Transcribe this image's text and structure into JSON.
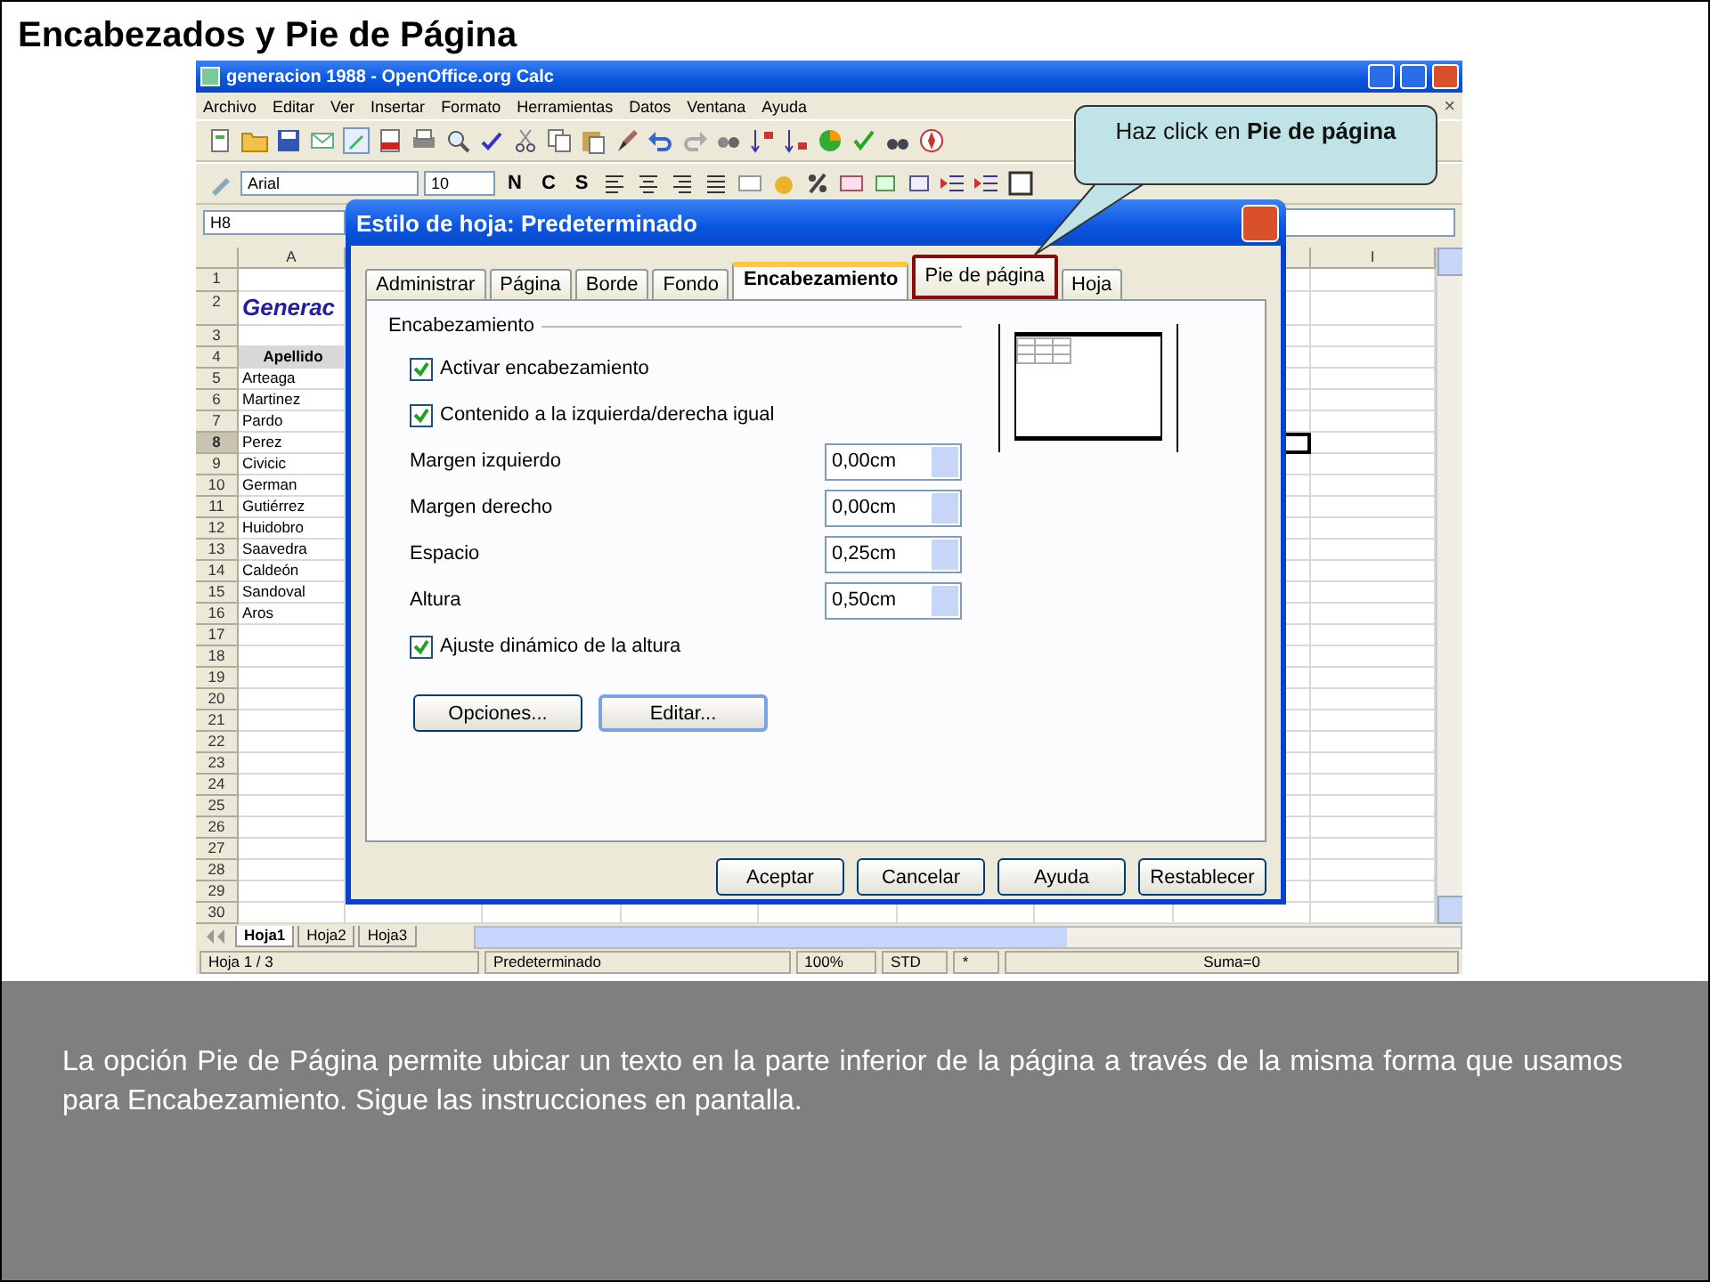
{
  "slide_title": "Encabezados y Pie de Página",
  "window": {
    "title": "generacion 1988 - OpenOffice.org Calc"
  },
  "menu": [
    "Archivo",
    "Editar",
    "Ver",
    "Insertar",
    "Formato",
    "Herramientas",
    "Datos",
    "Ventana",
    "Ayuda"
  ],
  "menu_close": "×",
  "format_toolbar": {
    "font": "Arial",
    "size": "10",
    "style_buttons": [
      "N",
      "C",
      "S"
    ]
  },
  "name_box": "H8",
  "columns": [
    "A",
    "I"
  ],
  "rows": [
    {
      "number": "1",
      "kind": "empty",
      "selected": false
    },
    {
      "number": "2",
      "kind": "title",
      "cell_a": "Generac",
      "selected": false
    },
    {
      "number": "3",
      "kind": "empty",
      "selected": false
    },
    {
      "number": "4",
      "kind": "header",
      "cell_a": "Apellido",
      "selected": false
    },
    {
      "number": "5",
      "kind": "name",
      "cell_a": "Arteaga",
      "selected": false
    },
    {
      "number": "6",
      "kind": "name",
      "cell_a": "Martinez",
      "selected": false
    },
    {
      "number": "7",
      "kind": "name",
      "cell_a": "Pardo",
      "selected": false
    },
    {
      "number": "8",
      "kind": "name",
      "cell_a": "Perez",
      "selected": true
    },
    {
      "number": "9",
      "kind": "name",
      "cell_a": "Civicic",
      "selected": false
    },
    {
      "number": "10",
      "kind": "name",
      "cell_a": "German",
      "selected": false
    },
    {
      "number": "11",
      "kind": "name",
      "cell_a": "Gutiérrez",
      "selected": false
    },
    {
      "number": "12",
      "kind": "name",
      "cell_a": "Huidobro",
      "selected": false
    },
    {
      "number": "13",
      "kind": "name",
      "cell_a": "Saavedra",
      "selected": false
    },
    {
      "number": "14",
      "kind": "name",
      "cell_a": "Caldeón",
      "selected": false
    },
    {
      "number": "15",
      "kind": "name",
      "cell_a": "Sandoval",
      "selected": false
    },
    {
      "number": "16",
      "kind": "name",
      "cell_a": "Aros",
      "selected": false
    },
    {
      "number": "17",
      "kind": "empty",
      "selected": false
    },
    {
      "number": "18",
      "kind": "empty",
      "selected": false
    },
    {
      "number": "19",
      "kind": "empty",
      "selected": false
    },
    {
      "number": "20",
      "kind": "empty",
      "selected": false
    },
    {
      "number": "21",
      "kind": "empty",
      "selected": false
    },
    {
      "number": "22",
      "kind": "empty",
      "selected": false
    },
    {
      "number": "23",
      "kind": "empty",
      "selected": false
    },
    {
      "number": "24",
      "kind": "empty",
      "selected": false
    },
    {
      "number": "25",
      "kind": "empty",
      "selected": false
    },
    {
      "number": "26",
      "kind": "empty",
      "selected": false
    },
    {
      "number": "27",
      "kind": "empty",
      "selected": false
    },
    {
      "number": "28",
      "kind": "empty",
      "selected": false
    },
    {
      "number": "29",
      "kind": "empty",
      "selected": false
    },
    {
      "number": "30",
      "kind": "empty",
      "selected": false
    }
  ],
  "sheet_tabs": [
    {
      "label": "Hoja1",
      "selected": true
    },
    {
      "label": "Hoja2",
      "selected": false
    },
    {
      "label": "Hoja3",
      "selected": false
    }
  ],
  "status_bar": [
    "Hoja 1 / 3",
    "Predeterminado",
    "100%",
    "STD",
    "*",
    "Suma=0"
  ],
  "dialog": {
    "title": "Estilo de hoja: Predeterminado",
    "tabs": [
      {
        "label": "Administrar",
        "selected": false,
        "highlighted": false
      },
      {
        "label": "Página",
        "selected": false,
        "highlighted": false
      },
      {
        "label": "Borde",
        "selected": false,
        "highlighted": false
      },
      {
        "label": "Fondo",
        "selected": false,
        "highlighted": false
      },
      {
        "label": "Encabezamiento",
        "selected": true,
        "highlighted": false
      },
      {
        "label": "Pie de página",
        "selected": false,
        "highlighted": true
      },
      {
        "label": "Hoja",
        "selected": false,
        "highlighted": false
      }
    ],
    "group_label": "Encabezamiento",
    "settings": [
      {
        "kind": "checkbox",
        "label": "Activar encabezamiento",
        "checked": true
      },
      {
        "kind": "checkbox",
        "label": "Contenido a la izquierda/derecha igual",
        "checked": true
      },
      {
        "kind": "spin",
        "label": "Margen izquierdo",
        "value": "0,00cm"
      },
      {
        "kind": "spin",
        "label": "Margen derecho",
        "value": "0,00cm"
      },
      {
        "kind": "spin",
        "label": "Espacio",
        "value": "0,25cm"
      },
      {
        "kind": "spin",
        "label": "Altura",
        "value": "0,50cm"
      },
      {
        "kind": "checkbox",
        "label": "Ajuste dinámico de la altura",
        "checked": true
      }
    ],
    "panel_buttons": [
      {
        "label": "Opciones...",
        "focused": false
      },
      {
        "label": "Editar...",
        "focused": true
      }
    ],
    "buttons": [
      "Aceptar",
      "Cancelar",
      "Ayuda",
      "Restablecer"
    ]
  },
  "callout": "Haz click en **Pie de página**",
  "caption": "La opción Pie de Página permite ubicar un texto en la parte inferior de la página a través de la misma forma que usamos para Encabezamiento. Sigue las instrucciones en pantalla."
}
